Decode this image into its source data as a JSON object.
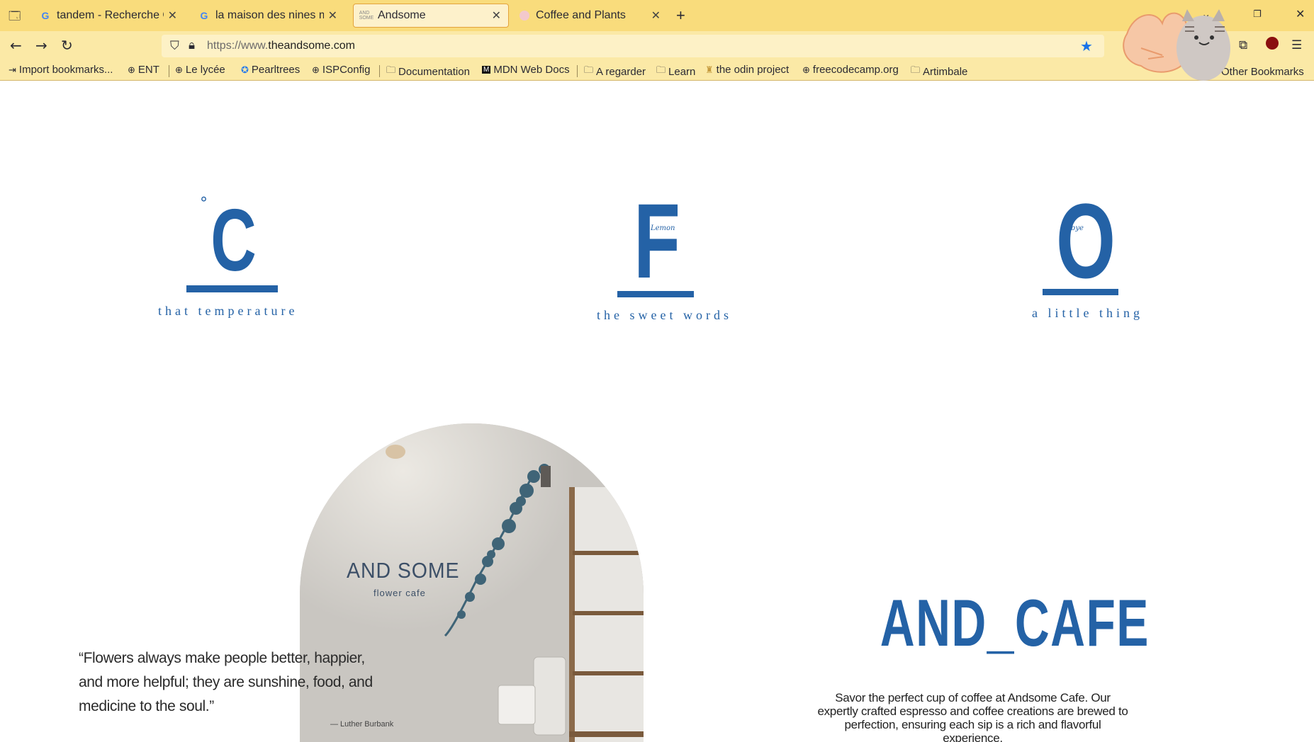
{
  "browser": {
    "tabs": [
      {
        "title": "tandem - Recherche Google",
        "favicon": "google-icon",
        "active": false
      },
      {
        "title": "la maison des nines marseille",
        "favicon": "google-icon",
        "active": false
      },
      {
        "title": "Andsome",
        "favicon": "andsome-icon",
        "active": true
      },
      {
        "title": "Coffee and Plants",
        "favicon": "pink-dot-icon",
        "active": false
      }
    ],
    "url_prefix": "https://www.",
    "url_domain": "theandsome.com",
    "bookmarks": [
      {
        "label": "Import bookmarks...",
        "icon": "import-icon"
      },
      {
        "label": "ENT",
        "icon": "globe-icon"
      },
      {
        "label": "Le lycée",
        "icon": "globe-icon"
      },
      {
        "label": "Pearltrees",
        "icon": "pearltrees-icon"
      },
      {
        "label": "ISPConfig",
        "icon": "globe-icon"
      },
      {
        "label": "Documentation",
        "icon": "folder-icon"
      },
      {
        "label": "MDN Web Docs",
        "icon": "mdn-icon"
      },
      {
        "label": "A regarder",
        "icon": "folder-icon"
      },
      {
        "label": "Learn",
        "icon": "folder-icon"
      },
      {
        "label": "the odin project",
        "icon": "odin-icon"
      },
      {
        "label": "freecodecamp.org",
        "icon": "globe-icon"
      },
      {
        "label": "Artimbale",
        "icon": "folder-icon"
      }
    ],
    "other_bookmarks": "Other Bookmarks",
    "accent": "#f9dc7c"
  },
  "page": {
    "features": [
      {
        "letter": "C",
        "superscript": "°",
        "caption": "that temperature"
      },
      {
        "letter": "F",
        "script": "Lemon",
        "caption": "the sweet words"
      },
      {
        "letter": "O",
        "script": "bye",
        "caption": "a little thing"
      }
    ],
    "sign_title": "AND SOME",
    "sign_subtitle": "flower cafe",
    "quote": "“Flowers always make people better, happier, and more helpful; they are sunshine, food, and medicine to the soul.”",
    "quote_author": "— Luther Burbank",
    "brand": "AND_CAFE",
    "description": "Savor the perfect cup of coffee at Andsome Cafe. Our expertly crafted espresso and coffee creations are brewed to perfection, ensuring each sip is a rich and flavorful experience.",
    "brand_color": "#2462a6"
  }
}
